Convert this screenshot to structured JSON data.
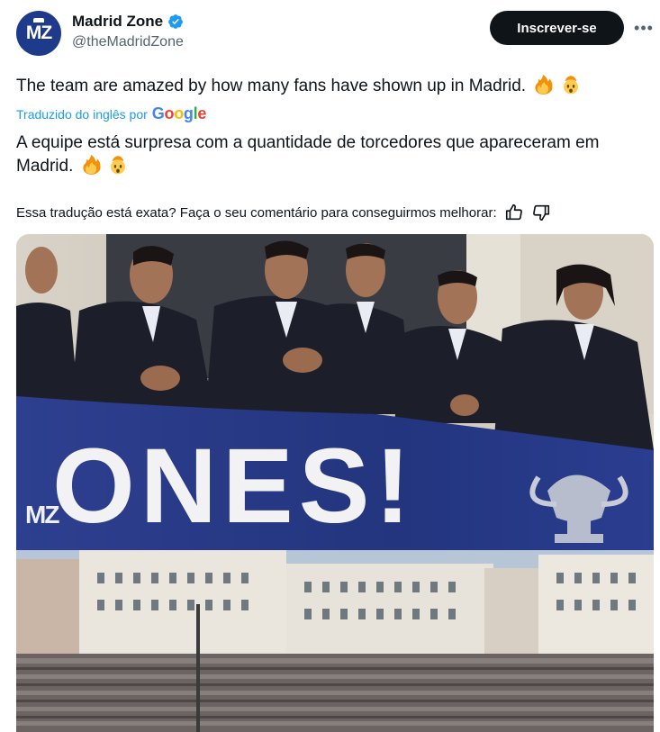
{
  "header": {
    "avatar_text": "MZ",
    "display_name": "Madrid Zone",
    "handle": "@theMadridZone",
    "subscribe_label": "Inscrever-se",
    "more_label": "•••"
  },
  "tweet": {
    "text": "The team are amazed by how many fans have shown up in Madrid.",
    "translated_label": "Traduzido do inglês por",
    "translator": "Google",
    "translation": "A equipe está surpresa com a quantidade de torcedores que apareceram em Madrid.",
    "emojis": [
      "fire-emoji",
      "exploding-head-emoji"
    ]
  },
  "feedback": {
    "question": "Essa tradução está exata? Faça o seu comentário para conseguirmos melhorar:",
    "icons": [
      "thumbs-up-icon",
      "thumbs-down-icon"
    ]
  },
  "media": {
    "watermark": "MZ",
    "banner_text": "ONES!"
  },
  "colors": {
    "accent": "#1d9bf0",
    "text": "#0f1419",
    "secondary": "#536471",
    "button": "#0f1419"
  }
}
